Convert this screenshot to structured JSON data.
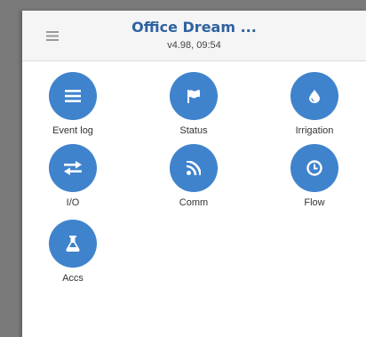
{
  "header": {
    "title": "Office Dream ...",
    "subtitle": "v4.98, 09:54",
    "menu_icon": "hamburger-icon"
  },
  "tiles": [
    {
      "label": "Event log",
      "icon": "list-icon"
    },
    {
      "label": "Status",
      "icon": "flag-icon"
    },
    {
      "label": "Irrigation",
      "icon": "water-drop-icon"
    },
    {
      "label": "I/O",
      "icon": "exchange-arrows-icon"
    },
    {
      "label": "Comm",
      "icon": "rss-feed-icon"
    },
    {
      "label": "Flow",
      "icon": "clock-icon"
    },
    {
      "label": "Accs",
      "icon": "flask-icon"
    }
  ],
  "colors": {
    "accent": "#3f83cc",
    "title": "#2f62a0",
    "backdrop": "#7a7a7a"
  }
}
